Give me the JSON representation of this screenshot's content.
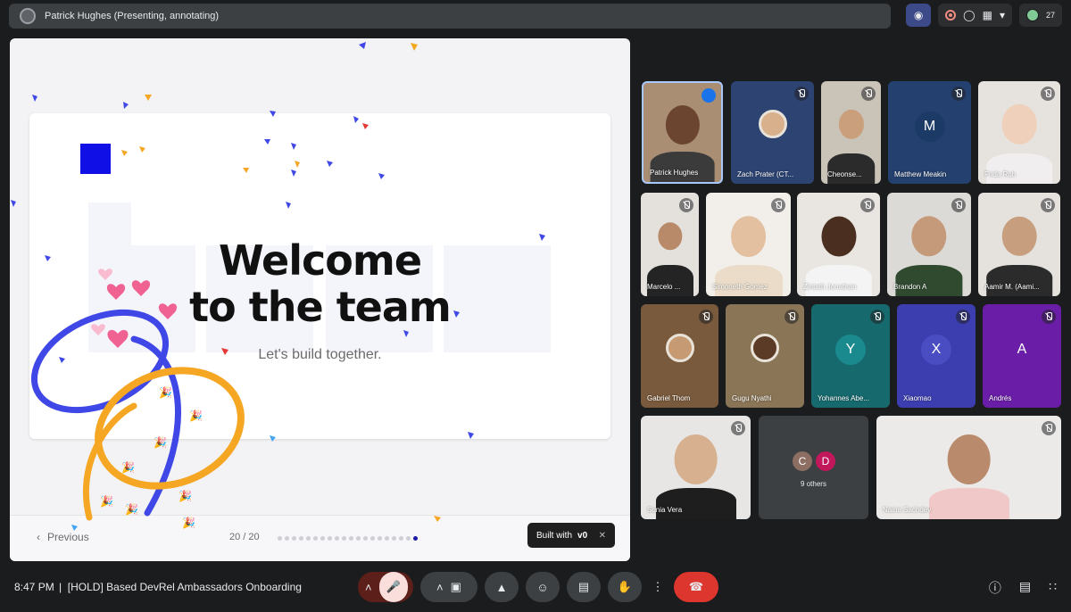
{
  "topbar": {
    "presenter_label": "Patrick Hughes (Presenting, annotating)",
    "participant_count": "27"
  },
  "slide": {
    "title_line1": "Welcome",
    "title_line2": "to the team",
    "subtitle": "Let's build together.",
    "prev_label": "Previous",
    "page_indicator": "20 / 20",
    "total_dots": 20,
    "active_dot": 20,
    "built_with_label": "Built with",
    "built_with_logo": "v0"
  },
  "participants": [
    {
      "name": "Patrick Hughes",
      "kind": "video",
      "skin": "#6b4530",
      "bg": "#a98e74",
      "shirt": "#3b3b3b",
      "speaking": true
    },
    {
      "name": "Zach Prater (CT...",
      "kind": "avatar-photo",
      "skin": "#d9b08c",
      "bg": "#2d4473",
      "muted": true
    },
    {
      "name": "Cheonse...",
      "kind": "video",
      "skin": "#caa07c",
      "bg": "#c9c3b8",
      "shirt": "#2b2b2b",
      "muted": true
    },
    {
      "name": "Matthew Meakin",
      "kind": "letter",
      "letter": "M",
      "bg": "#24406e",
      "letter_bg": "#1c3a66",
      "muted": true
    },
    {
      "name": "Frida Ruh",
      "kind": "video",
      "skin": "#efd0bb",
      "bg": "#e6e2dd",
      "shirt": "#f0eeee",
      "muted": true
    },
    {
      "name": "Marcelo ...",
      "kind": "video",
      "skin": "#b98a6a",
      "bg": "#e4e1dc",
      "shirt": "#242424",
      "muted": true
    },
    {
      "name": "Simoneth Gomez",
      "kind": "video",
      "skin": "#e3c0a0",
      "bg": "#f2efea",
      "shirt": "#eadcc8",
      "muted": true
    },
    {
      "name": "Zintath Jonathan",
      "kind": "video",
      "skin": "#4a2e20",
      "bg": "#e9e6e2",
      "shirt": "#f4f4f4",
      "muted": true
    },
    {
      "name": "Brandon A",
      "kind": "video",
      "skin": "#c49a7a",
      "bg": "#dcdad6",
      "shirt": "#304a30",
      "muted": true
    },
    {
      "name": "Aamir M. (Aami...",
      "kind": "video",
      "skin": "#c79f7f",
      "bg": "#e5e2dd",
      "shirt": "#2b2b2b",
      "muted": true
    },
    {
      "name": "Gabriel Thom",
      "kind": "avatar-photo",
      "skin": "#c69b74",
      "bg": "#7a5a3c",
      "muted": true
    },
    {
      "name": "Gugu Nyathi",
      "kind": "avatar-photo",
      "skin": "#5b3a26",
      "bg": "#8a7556",
      "muted": true
    },
    {
      "name": "Yohannes Abe...",
      "kind": "letter",
      "letter": "Y",
      "bg": "#166a6e",
      "letter_bg": "#1b8a8f",
      "muted": true
    },
    {
      "name": "Xiaomao",
      "kind": "letter",
      "letter": "X",
      "bg": "#3c3eb0",
      "letter_bg": "#4a4cc2",
      "muted": true
    },
    {
      "name": "Andrés",
      "kind": "letter",
      "letter": "A",
      "bg": "#6a1ea8",
      "letter_bg": "#6a1ea8",
      "muted": true
    },
    {
      "name": "Sonia Vera",
      "kind": "video",
      "skin": "#d6b08f",
      "bg": "#e8e6e4",
      "shirt": "#1e1e1e",
      "muted": true
    },
    {
      "name": "Naina Sachdev",
      "kind": "video",
      "skin": "#b98a6c",
      "bg": "#eceae8",
      "shirt": "#f0c8c8",
      "muted": true
    }
  ],
  "others": {
    "label": "9 others",
    "a": "C",
    "b": "D",
    "a_color": "#8d6e63",
    "b_color": "#c2185b"
  },
  "bottom": {
    "time": "8:47 PM",
    "separator": "|",
    "meeting_title": "[HOLD] Based DevRel Ambassadors Onboarding"
  },
  "colors": {
    "accent": "#a8c7fa",
    "hangup": "#dc362e",
    "slide_blue": "#1a1aa6",
    "orange": "#f5a623"
  }
}
